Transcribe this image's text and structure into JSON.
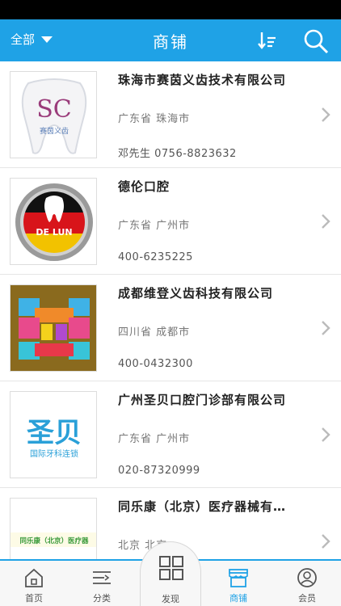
{
  "header": {
    "filter_label": "全部",
    "title": "商铺",
    "sort_icon": "sort-icon",
    "search_icon": "search-icon"
  },
  "shops": [
    {
      "name": "珠海市赛茵义齿技术有限公司",
      "region": "广东省 珠海市",
      "phone": "邓先生 0756-8823632",
      "logo_text": "赛茵义齿"
    },
    {
      "name": "德伦口腔",
      "region": "广东省 广州市",
      "phone": "400-6235225",
      "logo_text": "DE LUN"
    },
    {
      "name": "成都维登义齿科技有限公司",
      "region": "四川省 成都市",
      "phone": "400-0432300",
      "logo_text": ""
    },
    {
      "name": "广州圣贝口腔门诊部有限公司",
      "region": "广东省 广州市",
      "phone": "020-87320999",
      "logo_text": "圣贝",
      "logo_subtext": "国际牙科连锁"
    },
    {
      "name": "同乐康（北京）医疗器械有…",
      "region": "北京 北京",
      "phone": "",
      "logo_text": "同乐康（北京）医疗器"
    }
  ],
  "tabs": [
    {
      "label": "首页",
      "icon": "home-icon"
    },
    {
      "label": "分类",
      "icon": "category-icon"
    },
    {
      "label": "发现",
      "icon": "discover-icon"
    },
    {
      "label": "商铺",
      "icon": "shop-icon",
      "active": true
    },
    {
      "label": "会员",
      "icon": "member-icon"
    }
  ],
  "colors": {
    "accent": "#1fa2e6",
    "status_bar": "#000000",
    "tab_bg": "#f7f7f7"
  }
}
